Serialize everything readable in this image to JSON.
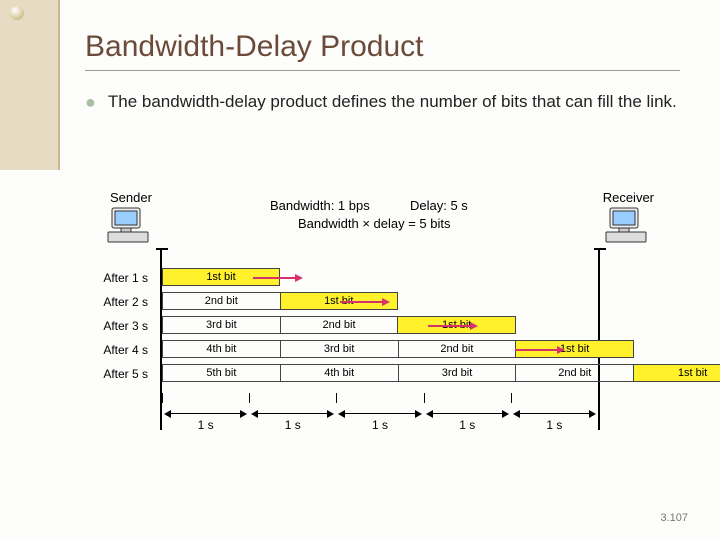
{
  "slide": {
    "title": "Bandwidth-Delay Product",
    "bullet": "The bandwidth-delay product defines the number of bits that can fill the link.",
    "page_number": "3.107"
  },
  "diagram": {
    "sender_label": "Sender",
    "receiver_label": "Receiver",
    "bandwidth_label": "Bandwidth: 1 bps",
    "delay_label": "Delay: 5 s",
    "product_label": "Bandwidth × delay = 5 bits",
    "rows": [
      {
        "label": "After 1 s",
        "cells": [
          "1st bit"
        ]
      },
      {
        "label": "After 2 s",
        "cells": [
          "2nd bit",
          "1st bit"
        ]
      },
      {
        "label": "After 3 s",
        "cells": [
          "3rd bit",
          "2nd bit",
          "1st bit"
        ]
      },
      {
        "label": "After 4 s",
        "cells": [
          "4th bit",
          "3rd bit",
          "2nd bit",
          "1st bit"
        ]
      },
      {
        "label": "After 5 s",
        "cells": [
          "5th bit",
          "4th bit",
          "3rd bit",
          "2nd bit",
          "1st bit"
        ]
      }
    ],
    "segment_label": "1 s",
    "num_segments": 5
  },
  "icons": {
    "computer": "computer-icon",
    "arrow_right": "arrow-right-icon"
  },
  "colors": {
    "title": "#6b4a39",
    "bullet_marker": "#a8bfa2",
    "highlight": "#fff22d",
    "arrow": "#d6336c"
  }
}
